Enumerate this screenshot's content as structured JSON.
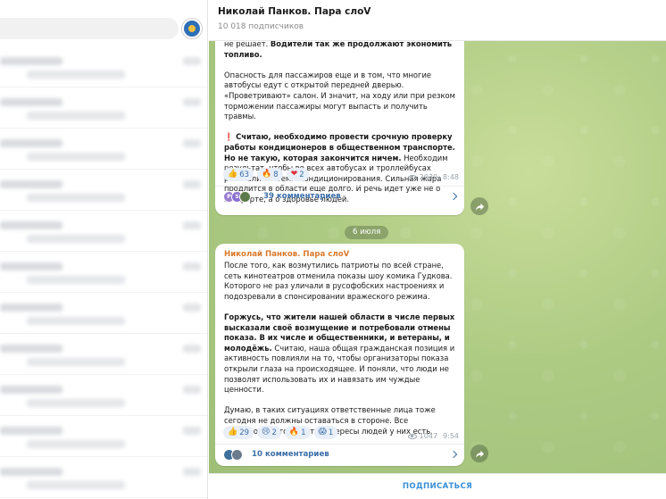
{
  "header": {
    "title": "Николай Панков. Пара слоV",
    "subscribers": "10 018 подписчиков"
  },
  "post1": {
    "paragraphs": [
      [
        {
          "t": "не решает. "
        },
        {
          "t": "Водители так же продолжают экономить топливо.",
          "b": true
        }
      ],
      [
        {
          "t": "Опасность для пассажиров еще и в том, что многие автобусы едут с открытой передней дверью. «Проветривают» салон. И значит, на ходу или при резком торможении пассажиры могут выпасть и получить травмы."
        }
      ],
      [
        {
          "t": "❗ ",
          "emoji": true
        },
        {
          "t": "Считаю, необходимо провести срочную проверку работы кондиционеров в общественном транспорте. Но не такую, которая закончится ничем.",
          "b": true
        },
        {
          "t": " Необходим результат, чтобы во всех автобусах и троллейбусах работали системы кондиционирования. Сильная жара продлится в области еще долго. И речь идет уже не о комфорте, а о здоровье людей."
        }
      ]
    ],
    "reactions": [
      {
        "emoji": "👍",
        "count": "63"
      },
      {
        "emoji": "🔥",
        "count": "8"
      },
      {
        "emoji": "❤",
        "count": "2"
      }
    ],
    "views": "2030",
    "time": "8:48",
    "comments_label": "39 комментариев",
    "commenter_avatars": [
      {
        "letter": "Р",
        "color": "#9b7fd1"
      },
      {
        "letter": "S",
        "color": "#8a6fd0"
      },
      {
        "letter": "",
        "color": "#5d7a4a"
      }
    ]
  },
  "date_divider": "6 июля",
  "post2": {
    "author": "Николай Панков. Пара слоV",
    "paragraphs": [
      [
        {
          "t": "После того, как возмутились патриоты по всей стране, сеть кинотеатров отменила показы шоу комика Гудкова. Которого не раз уличали в русофобских настроениях и подозревали в спонсировании вражеского режима."
        }
      ],
      [
        {
          "t": "Горжусь, что жители нашей области в числе первых высказали своё возмущение и потребовали отмены показа. В их числе и общественники, и ветераны, и молодёжь.",
          "b": true
        },
        {
          "t": " Считаю, наша общая гражданская позиция и активность повлияли на то, чтобы организаторы показа открыли глаза на происходящее. И поняли, что люди не позволят использовать их и навязать им чуждые ценности."
        }
      ],
      [
        {
          "t": "Думаю, в таких ситуациях ответственные лица тоже сегодня не должны оставаться  в стороне. Все полномочия отстаивать интересы людей у них есть."
        }
      ]
    ],
    "reactions": [
      {
        "emoji": "👍",
        "count": "29"
      },
      {
        "emoji": "😢",
        "count": "2"
      },
      {
        "emoji": "🔥",
        "count": "1"
      },
      {
        "emoji": "😱",
        "count": "1"
      }
    ],
    "views": "1047",
    "time": "9:54",
    "comments_label": "10 комментариев",
    "commenter_avatars": [
      {
        "letter": "",
        "color": "#3f6f9c"
      },
      {
        "letter": "",
        "color": "#6b7b8c"
      }
    ]
  },
  "footer": {
    "subscribe_label": "ПОДПИСАТЬСЯ"
  }
}
